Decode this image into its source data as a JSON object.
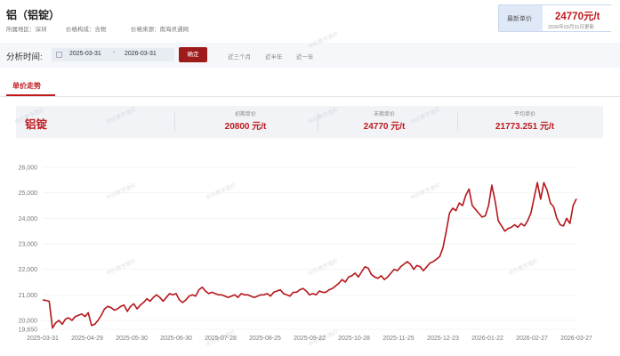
{
  "header": {
    "title": "铝（铝锭）",
    "region": "所属地区：深圳",
    "price_basis": "价格构成：含税",
    "source": "价格来源：南海灵通网",
    "latest_label": "最新单价",
    "latest_value": "24770元/t",
    "latest_date": "2026年03月31日更新"
  },
  "filter": {
    "label": "分析时间:",
    "start_date": "2025-03-31",
    "separator": "-",
    "end_date": "2026-03-31",
    "confirm_label": "确定",
    "quick_options": [
      "近三个月",
      "近半年",
      "近一年"
    ]
  },
  "tab": {
    "label": "单价走势"
  },
  "summary": {
    "name": "铝锭",
    "initial_label": "初期单价",
    "initial_value": "20800 元/t",
    "final_label": "末期单价",
    "final_value": "24770 元/t",
    "avg_label": "平均单价",
    "avg_value": "21773.251 元/t"
  },
  "watermark": "中乐数字造价",
  "chart_data": {
    "type": "line",
    "x_labels": [
      "2025-03-31",
      "2025-04-29",
      "2025-05-30",
      "2025-06-30",
      "2025-07-28",
      "2025-08-25",
      "2025-09-22",
      "2025-10-28",
      "2025-11-25",
      "2025-12-23",
      "2026-01-22",
      "2026-02-27",
      "2026-03-27"
    ],
    "y_ticks": [
      "19,650",
      "20,000",
      "21,000",
      "22,000",
      "23,000",
      "24,000",
      "25,000",
      "26,000"
    ],
    "ylim": [
      19650,
      26000
    ],
    "line_color": "#b5161c",
    "series": [
      {
        "values": [
          20800,
          20780,
          20750,
          19700,
          19900,
          20000,
          19850,
          20050,
          20100,
          20000,
          20150,
          20200,
          20250,
          20150,
          20300,
          19800,
          19850,
          20000,
          20200,
          20450,
          20550,
          20500,
          20400,
          20450,
          20550,
          20600,
          20350,
          20550,
          20650,
          20450,
          20600,
          20700,
          20850,
          20750,
          20900,
          21000,
          20900,
          20750,
          20900,
          21050,
          21000,
          21050,
          20800,
          20700,
          20800,
          20950,
          21000,
          20950,
          21200,
          21300,
          21150,
          21050,
          21100,
          21050,
          21000,
          21000,
          20950,
          20900,
          20950,
          21000,
          20900,
          21050,
          21000,
          21000,
          20950,
          20900,
          20950,
          21000,
          21000,
          21050,
          20950,
          21100,
          21150,
          21200,
          21050,
          21000,
          20950,
          21100,
          21100,
          21200,
          21250,
          21150,
          21000,
          21050,
          21000,
          21150,
          21100,
          21100,
          21200,
          21250,
          21350,
          21450,
          21600,
          21500,
          21700,
          21750,
          21850,
          21700,
          21900,
          22100,
          22050,
          21800,
          21700,
          21650,
          21750,
          21600,
          21700,
          21850,
          22000,
          21950,
          22100,
          22200,
          22300,
          22200,
          22000,
          22150,
          22100,
          21950,
          22100,
          22250,
          22300,
          22400,
          22500,
          22850,
          23500,
          24200,
          24400,
          24300,
          24600,
          24500,
          24900,
          25150,
          24500,
          24350,
          24200,
          24050,
          24100,
          24500,
          25300,
          24700,
          23900,
          23700,
          23500,
          23600,
          23650,
          23750,
          23650,
          23800,
          23700,
          23900,
          24200,
          24800,
          25400,
          24750,
          25400,
          25100,
          24600,
          24450,
          24000,
          23750,
          23700,
          24000,
          23800,
          24500,
          24770
        ]
      }
    ]
  }
}
